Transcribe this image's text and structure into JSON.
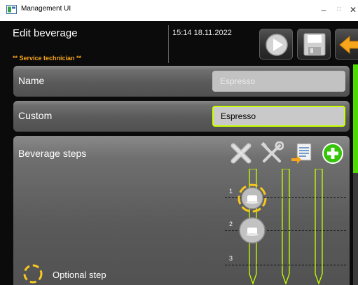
{
  "window": {
    "title": "Management UI",
    "minimize_glyph": "–",
    "maximize_glyph": "□",
    "close_glyph": "✕"
  },
  "header": {
    "title": "Edit beverage",
    "role": "** Service technician **",
    "datetime": "15:14 18.11.2022",
    "buttons": [
      "play-icon",
      "save-icon",
      "back-arrow-icon"
    ]
  },
  "colors": {
    "accent_green": "#4fda00",
    "highlight_yellow": "#f7c81e",
    "role_orange": "#f7a51c",
    "active_field_border": "#c8ff00"
  },
  "name_row": {
    "label": "Name",
    "value": "Espresso"
  },
  "custom_row": {
    "label": "Custom",
    "value": "Espresso"
  },
  "steps_panel": {
    "title": "Beverage steps",
    "toolbar_icons": [
      "delete-x-icon",
      "tools-icon",
      "import-document-icon",
      "add-plus-icon"
    ],
    "steps": [
      {
        "number": "1",
        "icon": "cup-icon",
        "optional": true
      },
      {
        "number": "2",
        "icon": "cup-icon",
        "optional": false
      },
      {
        "number": "3",
        "icon": "",
        "optional": false
      }
    ],
    "legend": {
      "label": "Optional step",
      "icon": "dashed-circle-icon"
    }
  }
}
